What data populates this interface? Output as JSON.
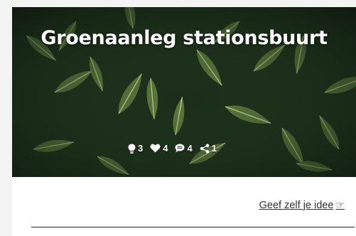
{
  "project": {
    "title": "Groenaanleg stationsbuurt",
    "stats": {
      "ideas": "3",
      "likes": "4",
      "comments": "4",
      "shares": "1"
    }
  },
  "cta": {
    "label": "Geef zelf je idee",
    "icon": "☞"
  },
  "colors": {
    "hero_overlay": "#142414",
    "leaf": "#5d7a3c",
    "text_light": "#ffffff",
    "text_dark": "#333333"
  }
}
